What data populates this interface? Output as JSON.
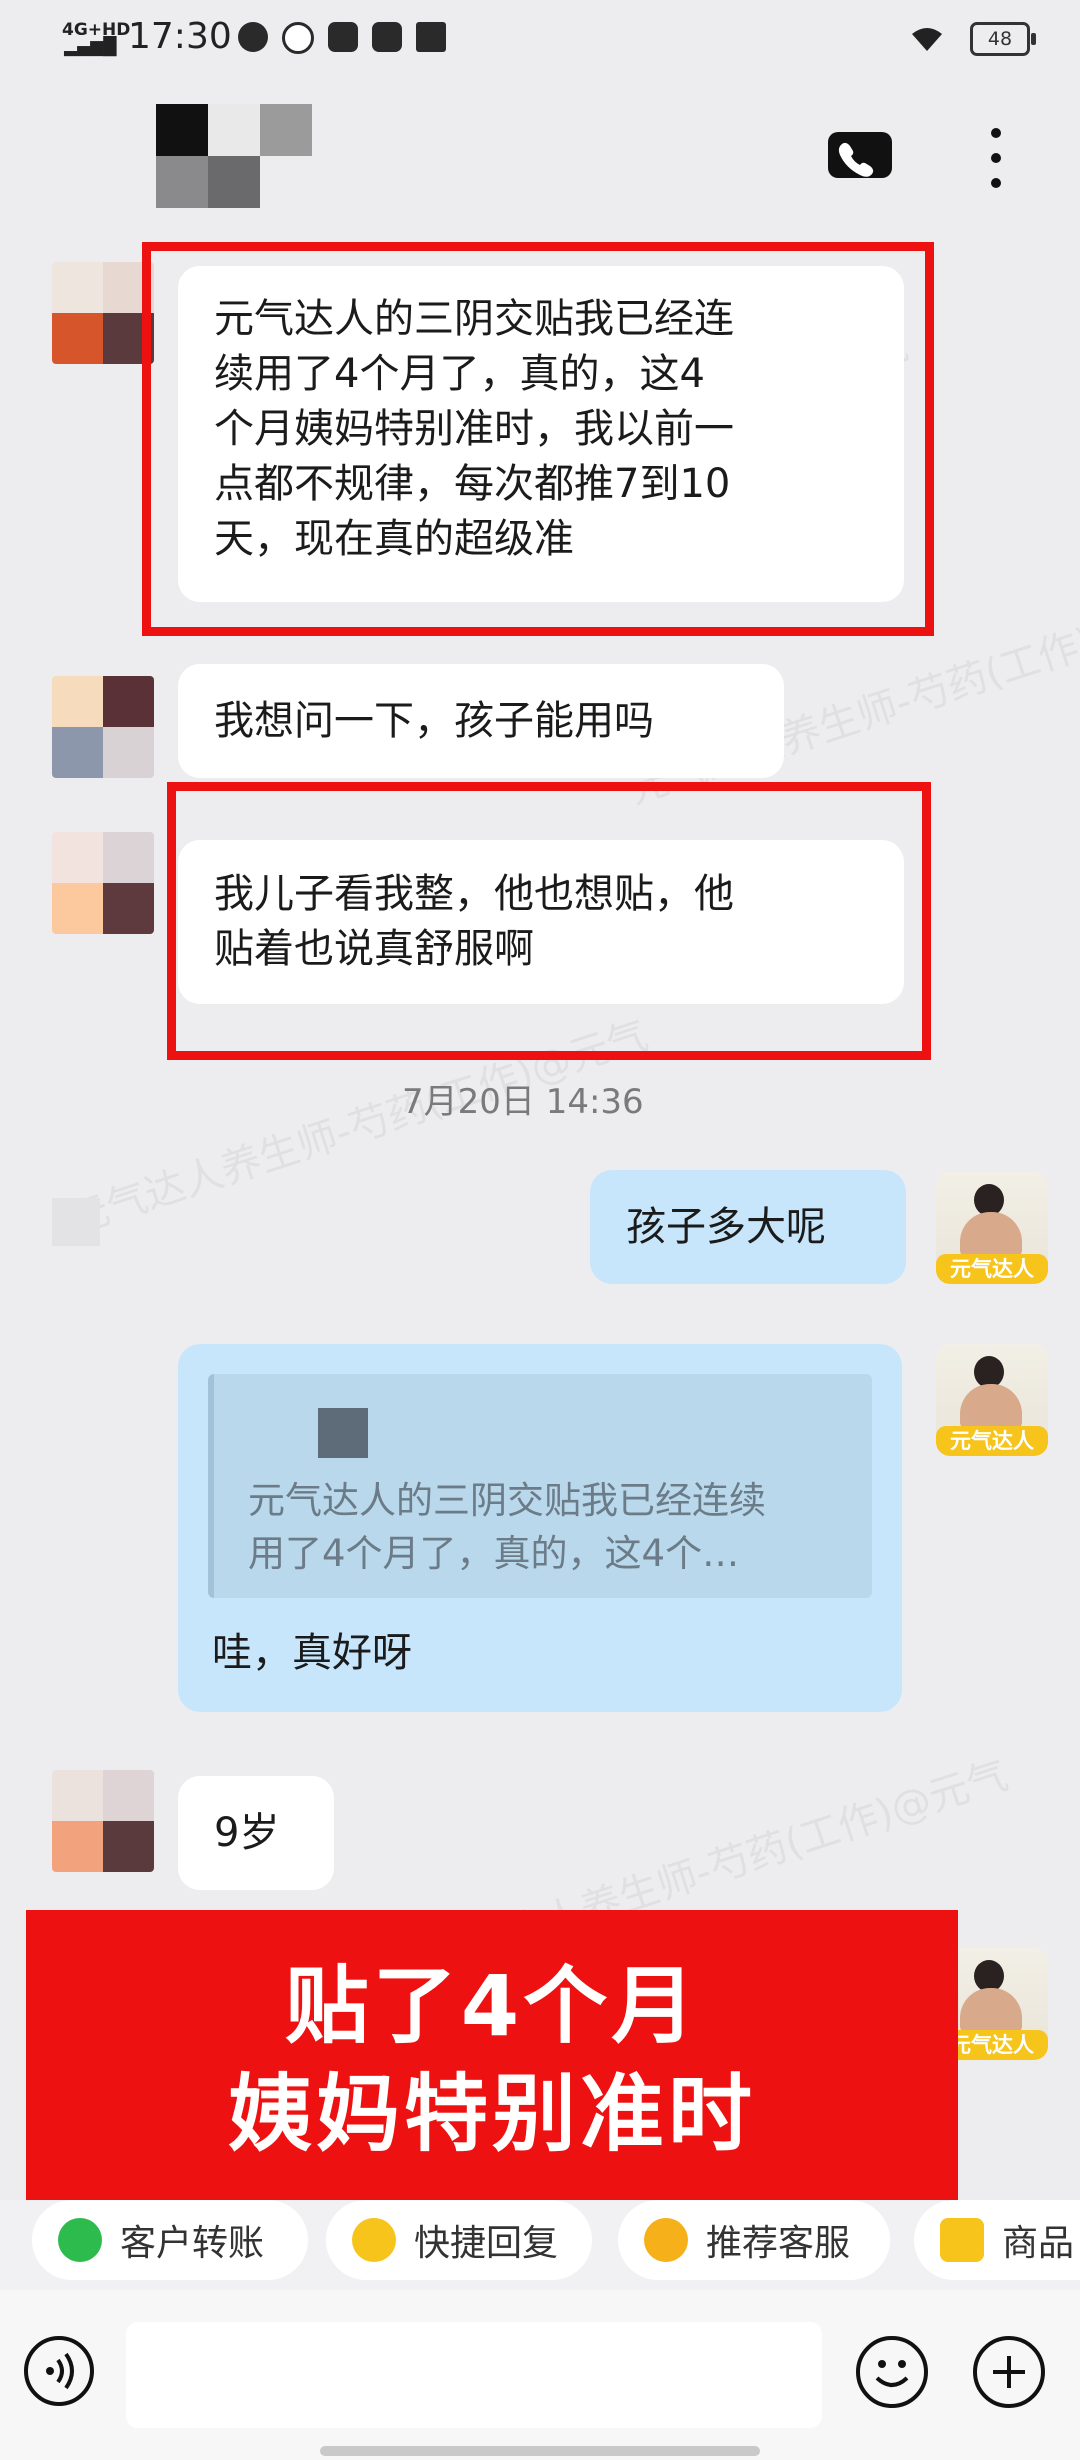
{
  "status_bar": {
    "network": "4G+HD",
    "time": "17:30",
    "battery": "48"
  },
  "messages": [
    {
      "side": "left",
      "text": "元气达人的三阴交贴我已经连续用了4个月了，真的，这4个月姨妈特别准时，我以前一点都不规律，每次都推7到10天，现在真的超级准",
      "lines": [
        "元气达人的三阴交贴我已经连",
        "续用了4个月了，真的，这4",
        "个月姨妈特别准时，我以前一",
        "点都不规律，每次都推7到10",
        "天，现在真的超级准"
      ],
      "highlighted": true
    },
    {
      "side": "left",
      "text": "我想问一下，孩子能用吗"
    },
    {
      "side": "left",
      "text": "我儿子看我整，他也想贴，他贴着也说真舒服啊",
      "lines": [
        "我儿子看我整，他也想贴，他",
        "贴着也说真舒服啊"
      ],
      "highlighted": true
    },
    {
      "side": "right",
      "text": "孩子多大呢"
    },
    {
      "side": "right",
      "quote_lines": [
        "元气达人的三阴交贴我已经连续",
        "用了4个月了，真的，这4个…"
      ],
      "text": "哇，真好呀"
    },
    {
      "side": "left",
      "text": "9岁"
    }
  ],
  "timestamp": "7月20日  14:36",
  "brand_badge": "元气达人",
  "watermark": "元气达人养生师-芍药(工作)@元气",
  "banner": {
    "line1": "贴了4个月",
    "line2": "姨妈特别准时"
  },
  "quick_actions": [
    {
      "label": "客户转账",
      "icon": "transfer-icon",
      "color": "#2dbb4e"
    },
    {
      "label": "快捷回复",
      "icon": "quick-reply-icon",
      "color": "#f6c41a"
    },
    {
      "label": "推荐客服",
      "icon": "recommend-icon",
      "color": "#f6b01a"
    },
    {
      "label": "商品",
      "icon": "product-icon",
      "color": "#f6c41a"
    }
  ]
}
